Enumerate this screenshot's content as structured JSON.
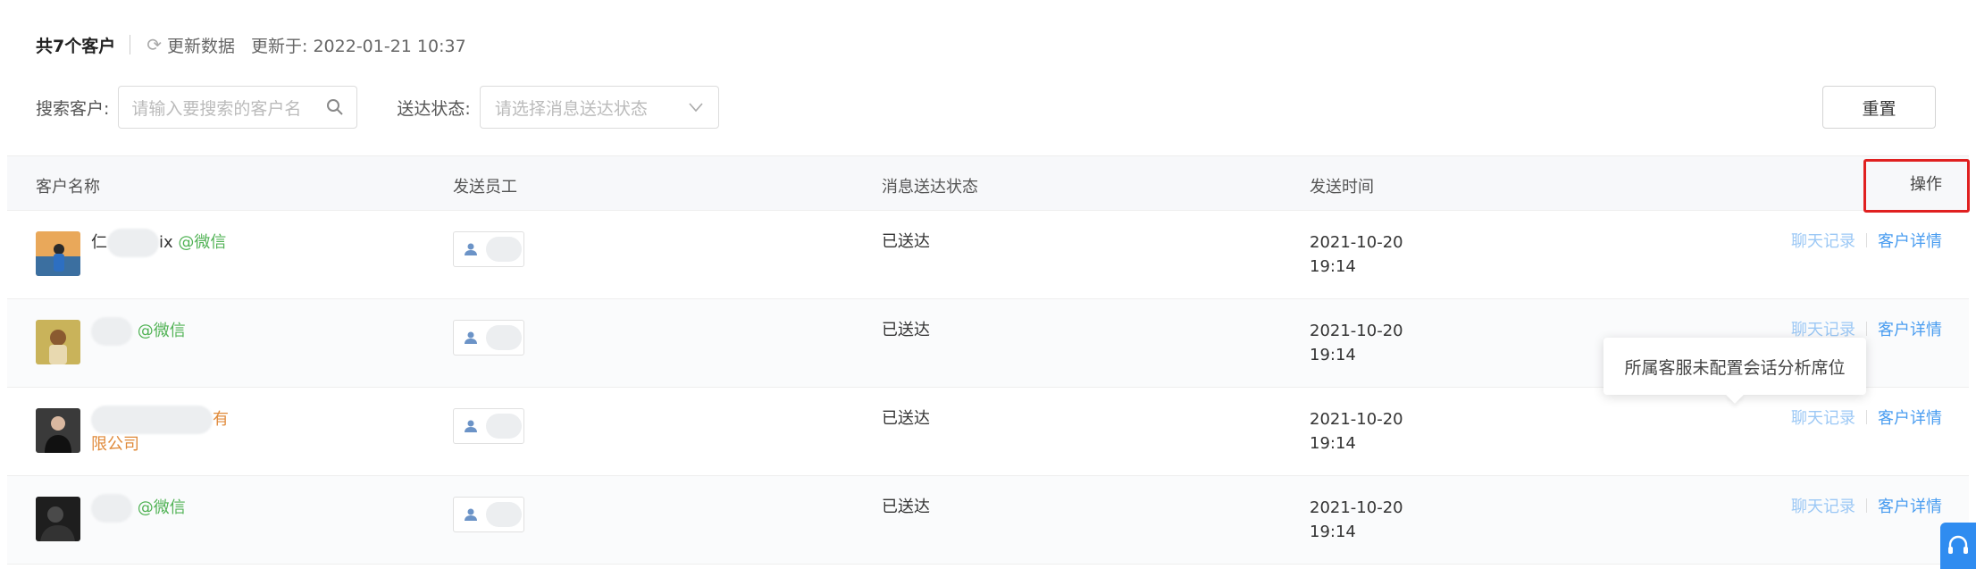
{
  "header": {
    "count": "共7个客户",
    "refresh_label": "更新数据",
    "updated_prefix": "更新于:",
    "updated_time": "2022-01-21 10:37"
  },
  "filters": {
    "search_label": "搜索客户:",
    "search_placeholder": "请输入要搜索的客户名",
    "status_label": "送达状态:",
    "status_placeholder": "请选择消息送达状态",
    "reset": "重置"
  },
  "table": {
    "columns": [
      "客户名称",
      "发送员工",
      "消息送达状态",
      "发送时间",
      "操作"
    ],
    "rows": [
      {
        "name_visible": "ix",
        "name_prefix": "仁",
        "tag": "@微信",
        "tag_type": "wechat",
        "status": "已送达",
        "date": "2021-10-20",
        "time": "19:14",
        "chat": "聊天记录",
        "detail": "客户详情"
      },
      {
        "name_visible": "",
        "name_prefix": "",
        "tag": "@微信",
        "tag_type": "wechat",
        "status": "已送达",
        "date": "2021-10-20",
        "time": "19:14",
        "chat": "聊天记录",
        "detail": "客户详情"
      },
      {
        "name_visible": "",
        "name_prefix": "",
        "tag": "限公司",
        "tag_type": "company",
        "company_tail": "有",
        "status": "已送达",
        "date": "2021-10-20",
        "time": "19:14",
        "chat": "聊天记录",
        "detail": "客户详情"
      },
      {
        "name_visible": "",
        "name_prefix": "",
        "tag": "@微信",
        "tag_type": "wechat",
        "status": "已送达",
        "date": "2021-10-20",
        "time": "19:14",
        "chat": "聊天记录",
        "detail": "客户详情"
      }
    ]
  },
  "tooltip": "所属客服未配置会话分析席位",
  "colors": {
    "link": "#4a9df0",
    "wechat": "#52b356",
    "company": "#e08a3a",
    "highlight": "#e02020",
    "support_button": "#2f8cf0"
  }
}
